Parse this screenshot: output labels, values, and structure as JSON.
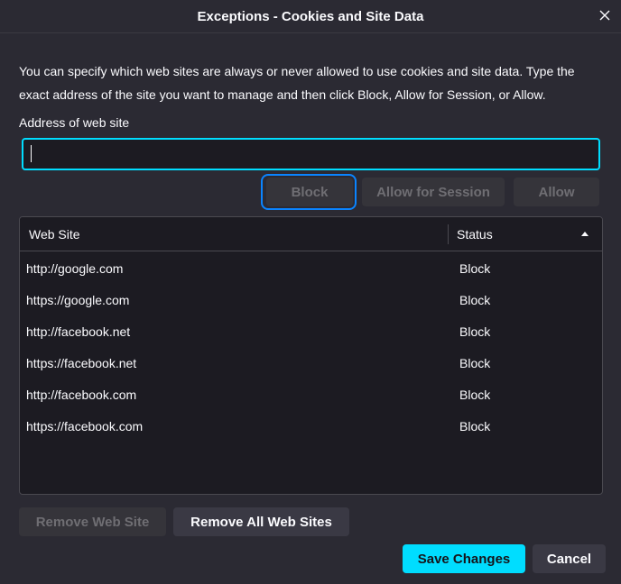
{
  "dialog": {
    "title": "Exceptions - Cookies and Site Data",
    "description": "You can specify which web sites are always or never allowed to use cookies and site data. Type the exact address of the site you want to manage and then click Block, Allow for Session, or Allow.",
    "address_label": "Address of web site",
    "address_value": ""
  },
  "actions": {
    "block_label": "Block",
    "allow_session_label": "Allow for Session",
    "allow_label": "Allow"
  },
  "table": {
    "columns": [
      "Web Site",
      "Status"
    ],
    "sort_icon": "sort-ascending-icon",
    "rows": [
      {
        "site": "http://google.com",
        "status": "Block"
      },
      {
        "site": "https://google.com",
        "status": "Block"
      },
      {
        "site": "http://facebook.net",
        "status": "Block"
      },
      {
        "site": "https://facebook.net",
        "status": "Block"
      },
      {
        "site": "http://facebook.com",
        "status": "Block"
      },
      {
        "site": "https://facebook.com",
        "status": "Block"
      }
    ]
  },
  "footer": {
    "remove_site_label": "Remove Web Site",
    "remove_all_label": "Remove All Web Sites",
    "save_label": "Save Changes",
    "cancel_label": "Cancel"
  },
  "colors": {
    "background": "#2b2a33",
    "input_focus": "#00ddff",
    "focus_ring": "#0a84ff",
    "primary_button": "#00ddff"
  }
}
